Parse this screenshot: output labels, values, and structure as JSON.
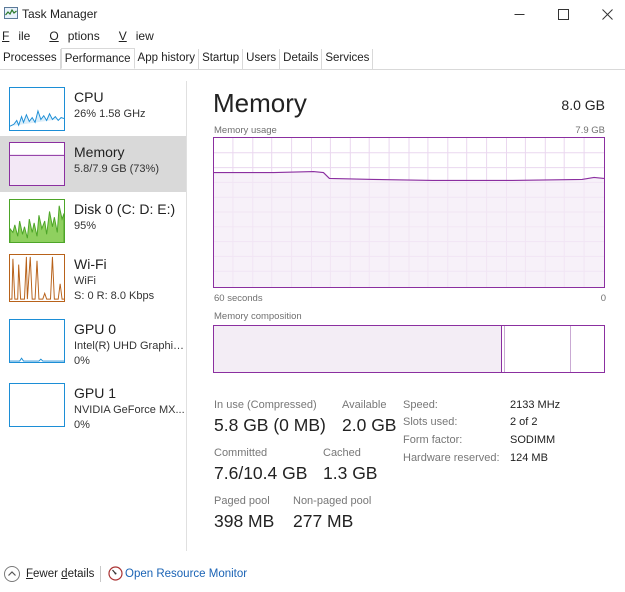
{
  "window": {
    "title": "Task Manager"
  },
  "menu": [
    {
      "label": "File",
      "u": "F",
      "rest": "ile"
    },
    {
      "label": "Options",
      "u": "O",
      "rest": "ptions"
    },
    {
      "label": "View",
      "u": "V",
      "rest": "iew"
    }
  ],
  "tabs": [
    "Processes",
    "Performance",
    "App history",
    "Startup",
    "Users",
    "Details",
    "Services"
  ],
  "active_tab": "Performance",
  "sidebar": [
    {
      "name": "CPU",
      "sub": "26%  1.58 GHz",
      "color": "#1c8ed6",
      "icon": "cpu-graph-icon"
    },
    {
      "name": "Memory",
      "sub": "5.8/7.9 GB (73%)",
      "color": "#8b2fa0",
      "icon": "memory-graph-icon"
    },
    {
      "name": "Disk 0 (C: D: E:)",
      "sub": "95%",
      "color": "#4da528",
      "icon": "disk-graph-icon"
    },
    {
      "name": "Wi-Fi",
      "sub": "WiFi",
      "sub2": "S: 0  R: 8.0 Kbps",
      "color": "#b8621a",
      "icon": "wifi-graph-icon"
    },
    {
      "name": "GPU 0",
      "sub": "Intel(R) UHD Graphic...",
      "sub2": "0%",
      "color": "#1c8ed6",
      "icon": "gpu-graph-icon"
    },
    {
      "name": "GPU 1",
      "sub": "NVIDIA GeForce MX...",
      "sub2": "0%",
      "color": "#1c8ed6",
      "icon": "gpu-graph-icon"
    }
  ],
  "main": {
    "title": "Memory",
    "total": "8.0 GB",
    "usage_label": "Memory usage",
    "usage_max": "7.9 GB",
    "time_left": "60 seconds",
    "time_right": "0",
    "composition_label": "Memory composition"
  },
  "stats": {
    "in_use_label": "In use (Compressed)",
    "in_use_value": "5.8 GB (0 MB)",
    "available_label": "Available",
    "available_value": "2.0 GB",
    "committed_label": "Committed",
    "committed_value": "7.6/10.4 GB",
    "cached_label": "Cached",
    "cached_value": "1.3 GB",
    "paged_label": "Paged pool",
    "paged_value": "398 MB",
    "nonpaged_label": "Non-paged pool",
    "nonpaged_value": "277 MB"
  },
  "details": [
    {
      "label": "Speed:",
      "value": "2133 MHz"
    },
    {
      "label": "Slots used:",
      "value": "2 of 2"
    },
    {
      "label": "Form factor:",
      "value": "SODIMM"
    },
    {
      "label": "Hardware reserved:",
      "value": "124 MB"
    }
  ],
  "footer": {
    "fewer_u": "F",
    "fewer_mid": "ewer ",
    "fewer_u2": "d",
    "fewer_rest": "etails",
    "resource_monitor": "Open Resource Monitor"
  },
  "colors": {
    "memory": "#8b2fa0",
    "link": "#1a63b5"
  }
}
